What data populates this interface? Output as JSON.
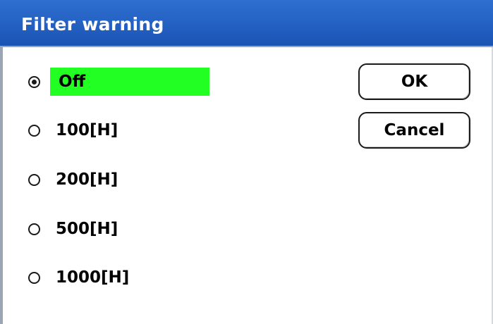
{
  "dialog": {
    "title": "Filter warning"
  },
  "options": [
    {
      "label": "Off",
      "selected": true
    },
    {
      "label": "100[H]",
      "selected": false
    },
    {
      "label": "200[H]",
      "selected": false
    },
    {
      "label": "500[H]",
      "selected": false
    },
    {
      "label": "1000[H]",
      "selected": false
    }
  ],
  "buttons": {
    "ok_label": "OK",
    "cancel_label": "Cancel"
  },
  "colors": {
    "title_bar": "#2563c4",
    "highlight": "#22ff22"
  }
}
